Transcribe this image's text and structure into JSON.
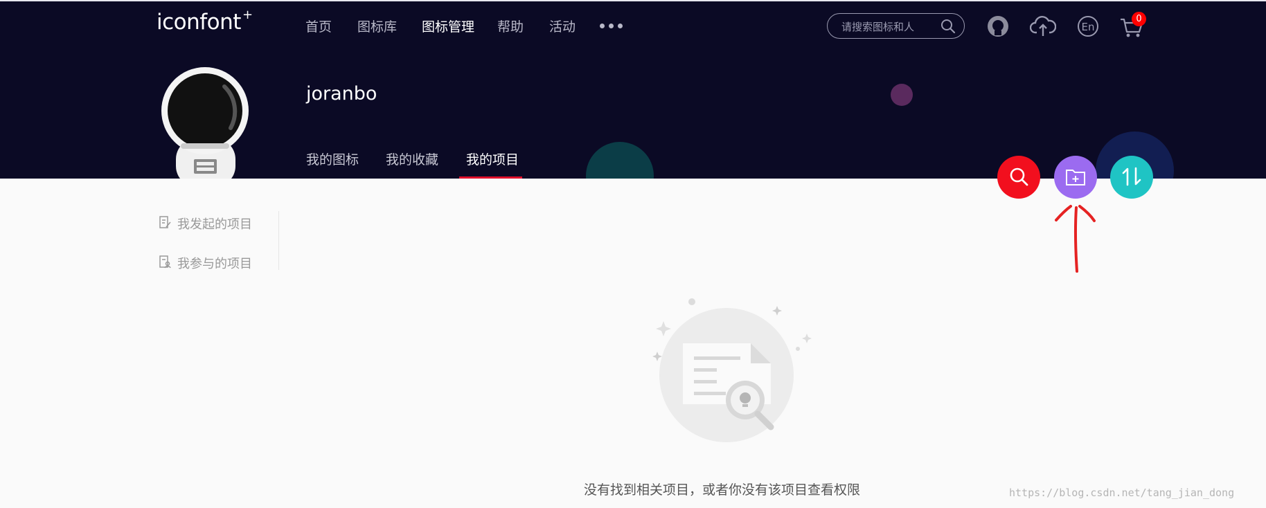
{
  "brand": {
    "logo_text": "iconfont",
    "logo_plus": "+"
  },
  "nav": {
    "items": [
      {
        "label": "首页",
        "active": false
      },
      {
        "label": "图标库",
        "active": false
      },
      {
        "label": "图标管理",
        "active": true
      },
      {
        "label": "帮助",
        "active": false
      },
      {
        "label": "活动",
        "active": false
      }
    ],
    "more_icon": "more-dots-icon"
  },
  "search": {
    "placeholder": "请搜索图标和人",
    "icon": "search-icon"
  },
  "header_icons": [
    "github-icon",
    "upload-cloud-icon",
    "language-en-icon",
    "cart-icon"
  ],
  "language_label": "En",
  "cart": {
    "count": "0"
  },
  "profile": {
    "username": "joranbo",
    "tabs": [
      {
        "label": "我的图标",
        "active": false
      },
      {
        "label": "我的收藏",
        "active": false
      },
      {
        "label": "我的项目",
        "active": true
      }
    ]
  },
  "actions": [
    {
      "name": "search-project-button",
      "icon": "search-icon",
      "color": "#f20f1e"
    },
    {
      "name": "new-project-button",
      "icon": "folder-add-icon",
      "color": "#9b6bf0"
    },
    {
      "name": "sort-button",
      "icon": "sort-icon",
      "color": "#1fc4c4"
    }
  ],
  "sidebar": {
    "items": [
      {
        "label": "我发起的项目",
        "icon": "edit-document-icon"
      },
      {
        "label": "我参与的项目",
        "icon": "user-document-icon"
      }
    ]
  },
  "empty_state": {
    "message": "没有找到相关项目，或者你没有该项目查看权限"
  },
  "watermark": "https://blog.csdn.net/tang_jian_dong",
  "colors": {
    "header_bg": "#0b0a25",
    "accent_red": "#e0102c",
    "page_bg": "#fafafa"
  }
}
